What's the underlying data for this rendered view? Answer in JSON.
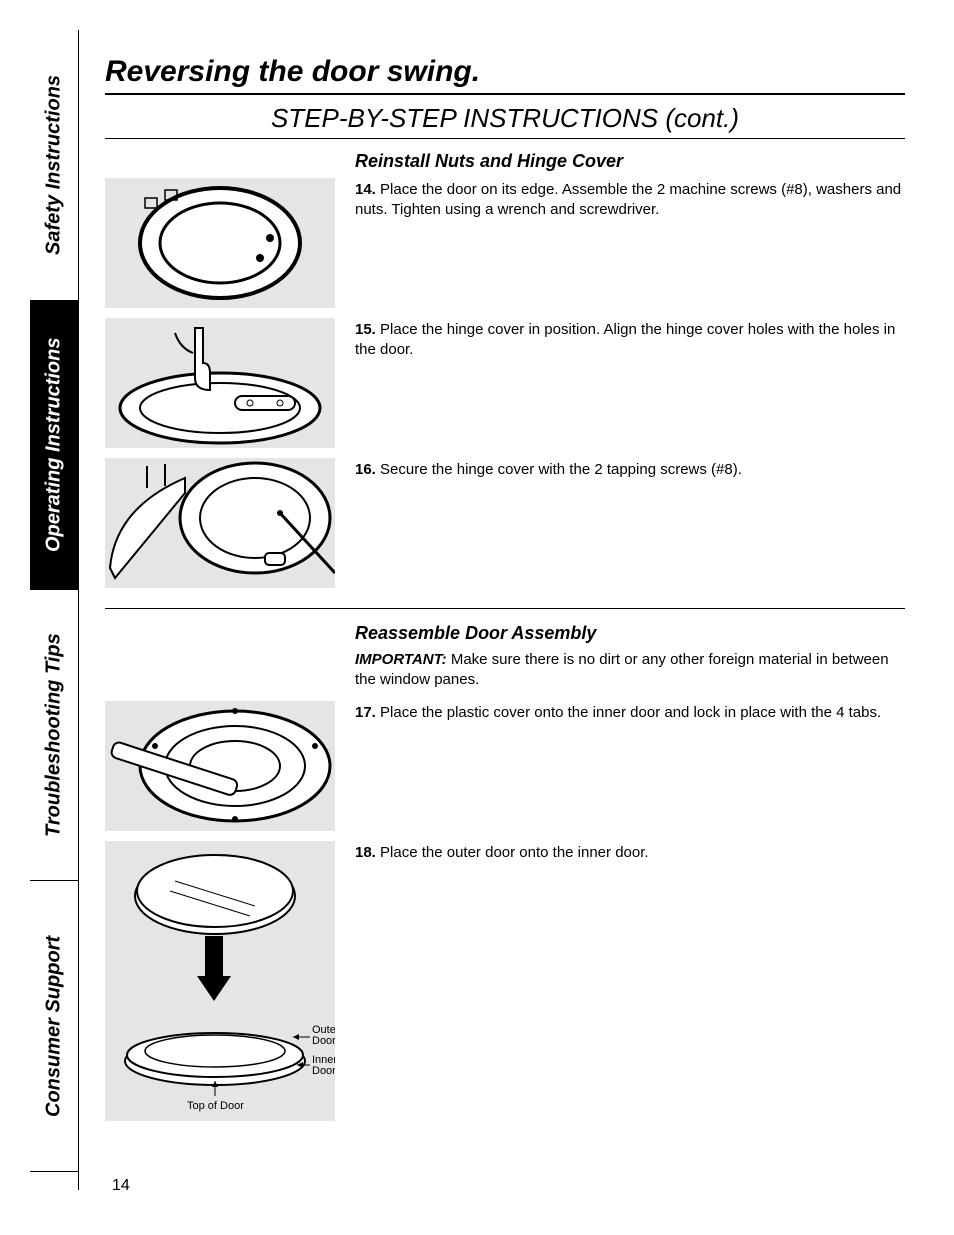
{
  "sidebar": {
    "tabs": [
      {
        "label": "Safety Instructions",
        "style": "white"
      },
      {
        "label": "Operating Instructions",
        "style": "black"
      },
      {
        "label": "Troubleshooting Tips",
        "style": "white"
      },
      {
        "label": "Consumer Support",
        "style": "white"
      }
    ]
  },
  "page": {
    "title": "Reversing the door swing.",
    "subtitle": "STEP-BY-STEP INSTRUCTIONS (cont.)",
    "number": "14"
  },
  "section1": {
    "header": "Reinstall Nuts and Hinge Cover",
    "steps": [
      {
        "num": "14.",
        "text": "Place the door on its edge. Assemble the 2 machine screws (#8), washers and nuts. Tighten using a wrench and screwdriver."
      },
      {
        "num": "15.",
        "text": "Place the hinge cover in position. Align the hinge cover holes with the holes in the door."
      },
      {
        "num": "16.",
        "text": "Secure the hinge cover with the 2 tapping screws (#8)."
      }
    ]
  },
  "section2": {
    "header": "Reassemble Door Assembly",
    "important_label": "IMPORTANT:",
    "important_text": "Make sure there is no dirt or any other foreign material in between the window panes.",
    "steps": [
      {
        "num": "17.",
        "text": "Place the plastic cover onto the inner door and lock in place with the 4 tabs."
      },
      {
        "num": "18.",
        "text": "Place the outer door onto the inner door."
      }
    ],
    "diagram_labels": {
      "outer": "Outer Door",
      "inner": "Inner Door",
      "top": "Top of Door"
    }
  }
}
